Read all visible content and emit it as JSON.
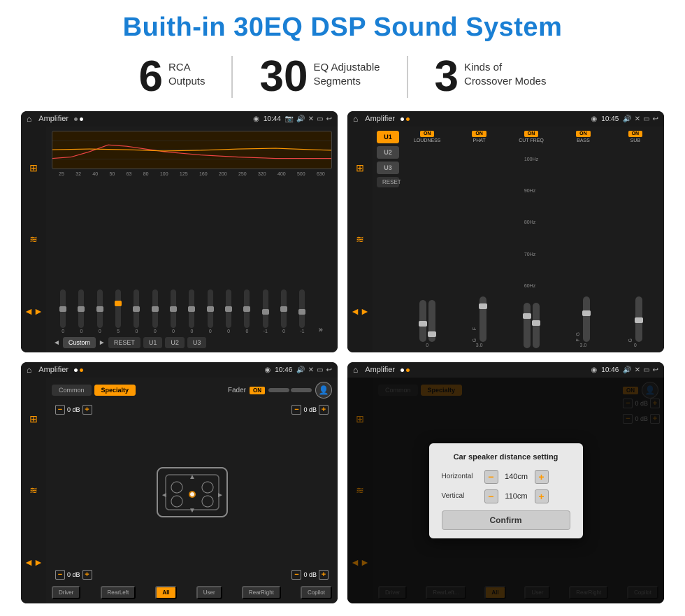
{
  "title": "Buith-in 30EQ DSP Sound System",
  "stats": [
    {
      "number": "6",
      "label": "RCA\nOutputs"
    },
    {
      "number": "30",
      "label": "EQ Adjustable\nSegments"
    },
    {
      "number": "3",
      "label": "Kinds of\nCrossover Modes"
    }
  ],
  "screens": [
    {
      "id": "eq-screen",
      "statusBar": {
        "title": "Amplifier",
        "time": "10:44"
      },
      "freqBands": [
        "25",
        "32",
        "40",
        "50",
        "63",
        "80",
        "100",
        "125",
        "160",
        "200",
        "250",
        "320",
        "400",
        "500",
        "630"
      ],
      "sliderValues": [
        "0",
        "0",
        "0",
        "5",
        "0",
        "0",
        "0",
        "0",
        "0",
        "0",
        "0",
        "-1",
        "0",
        "-1"
      ],
      "controls": [
        "Custom",
        "RESET",
        "U1",
        "U2",
        "U3"
      ]
    },
    {
      "id": "crossover-screen",
      "statusBar": {
        "title": "Amplifier",
        "time": "10:45"
      },
      "uButtons": [
        "U1",
        "U2",
        "U3"
      ],
      "columns": [
        "LOUDNESS",
        "PHAT",
        "CUT FREQ",
        "BASS",
        "SUB"
      ],
      "resetLabel": "RESET"
    },
    {
      "id": "fader-screen",
      "statusBar": {
        "title": "Amplifier",
        "time": "10:46"
      },
      "tabs": [
        "Common",
        "Specialty"
      ],
      "faderLabel": "Fader",
      "faderOn": "ON",
      "dbValues": [
        "0 dB",
        "0 dB",
        "0 dB",
        "0 dB"
      ],
      "bottomButtons": [
        "Driver",
        "RearLeft",
        "All",
        "User",
        "RearRight",
        "Copilot"
      ]
    },
    {
      "id": "dialog-screen",
      "statusBar": {
        "title": "Amplifier",
        "time": "10:46"
      },
      "tabs": [
        "Common",
        "Specialty"
      ],
      "dialog": {
        "title": "Car speaker distance setting",
        "horizontal": {
          "label": "Horizontal",
          "value": "140cm"
        },
        "vertical": {
          "label": "Vertical",
          "value": "110cm"
        },
        "confirmLabel": "Confirm"
      },
      "dbValues": [
        "0 dB",
        "0 dB"
      ],
      "bottomButtons": [
        "Driver",
        "RearLeft",
        "All",
        "User",
        "RearRight",
        "Copilot"
      ]
    }
  ]
}
